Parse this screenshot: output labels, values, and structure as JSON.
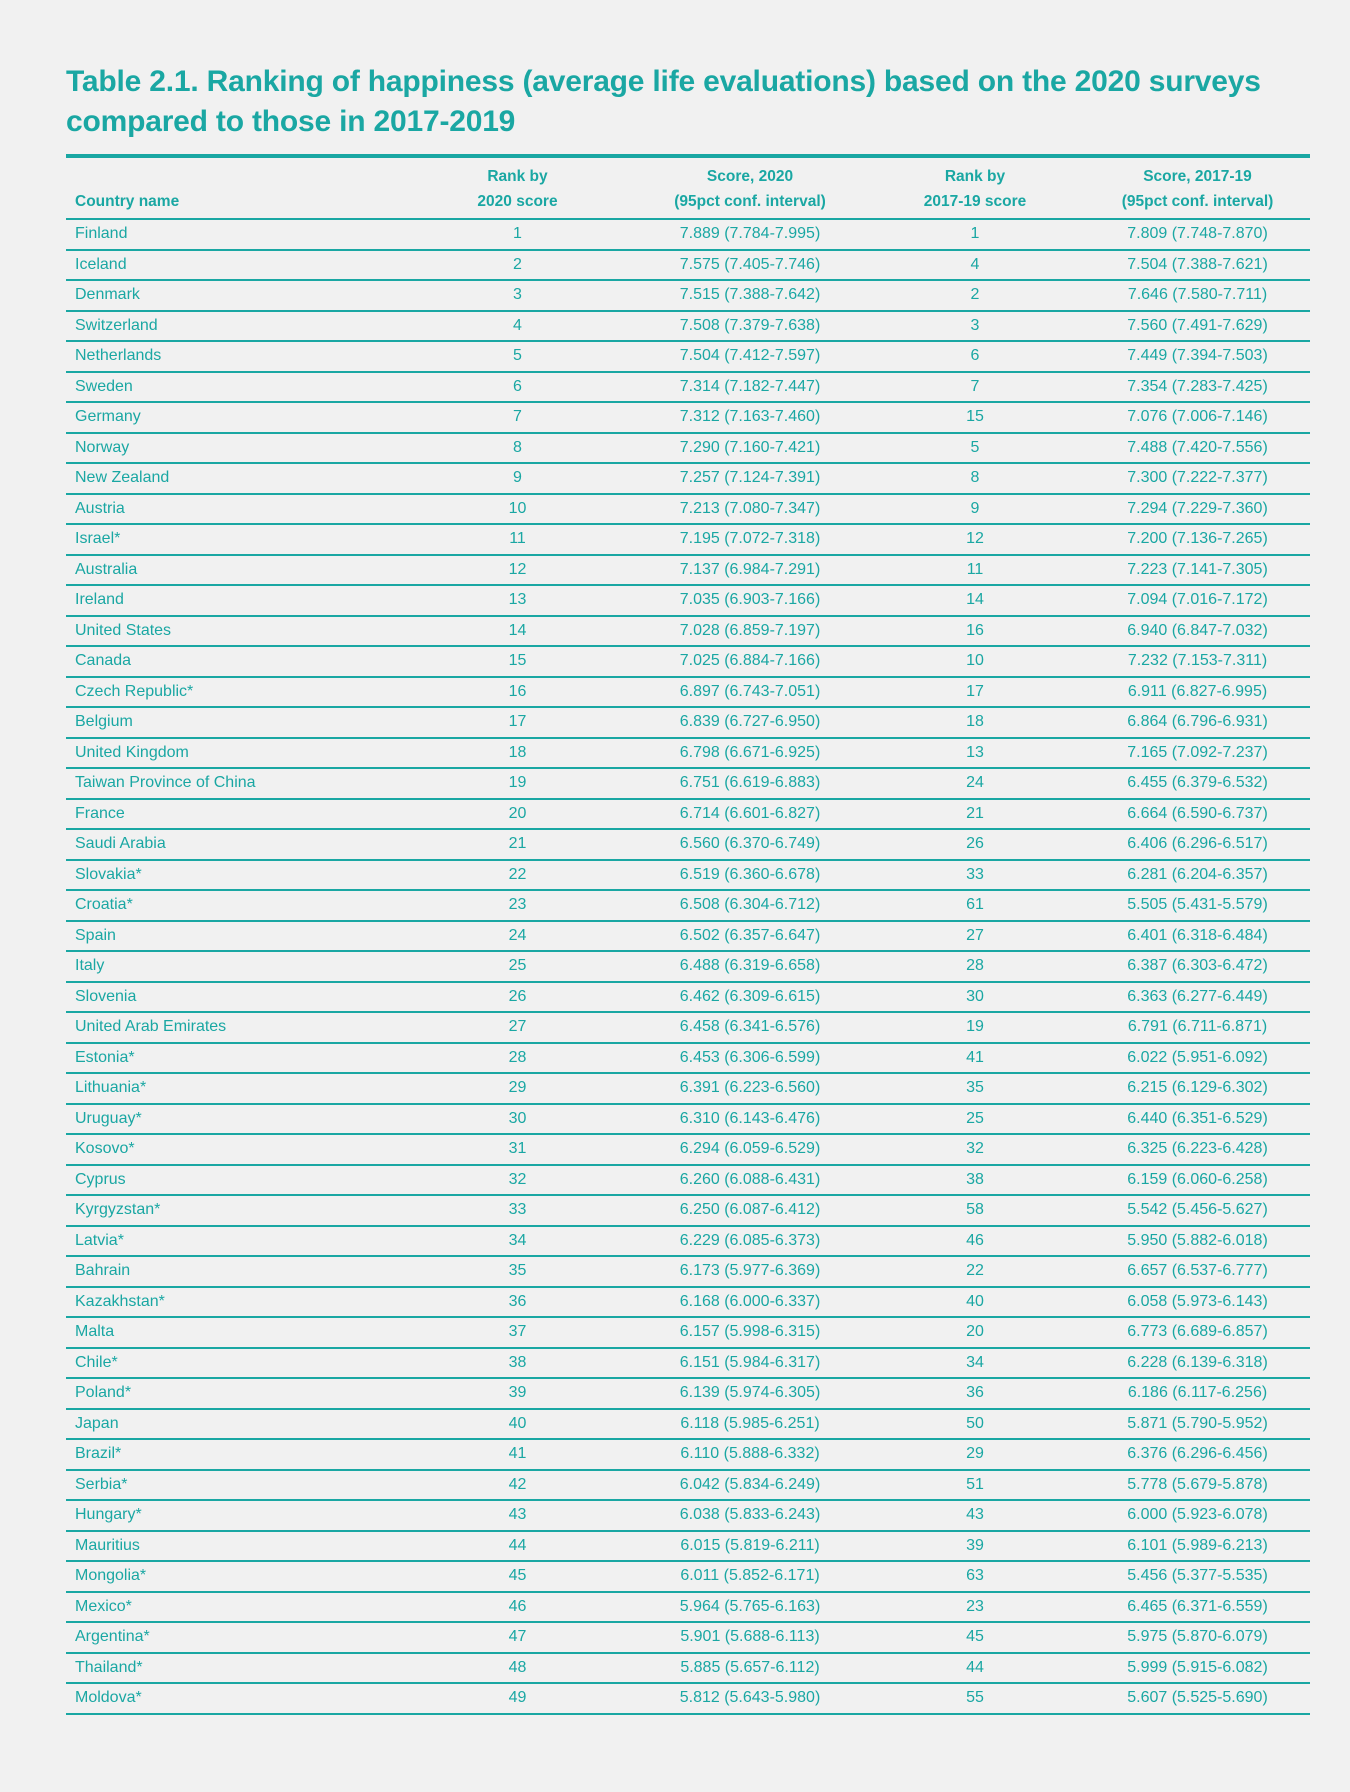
{
  "title": "Table 2.1. Ranking of happiness (average life evaluations) based on the 2020 surveys compared to those in 2017-2019",
  "colors": {
    "accent": "#1aa7a3",
    "background": "#f1f1f1"
  },
  "table": {
    "headers": [
      {
        "line1": "",
        "line2": "Country name"
      },
      {
        "line1": "Rank by",
        "line2": "2020 score"
      },
      {
        "line1": "Score, 2020",
        "line2": "(95pct conf. interval)"
      },
      {
        "line1": "Rank by",
        "line2": "2017-19 score"
      },
      {
        "line1": "Score, 2017-19",
        "line2": "(95pct conf. interval)"
      }
    ],
    "rows": [
      [
        "Finland",
        "1",
        "7.889 (7.784-7.995)",
        "1",
        "7.809 (7.748-7.870)"
      ],
      [
        "Iceland",
        "2",
        "7.575 (7.405-7.746)",
        "4",
        "7.504 (7.388-7.621)"
      ],
      [
        "Denmark",
        "3",
        "7.515 (7.388-7.642)",
        "2",
        "7.646 (7.580-7.711)"
      ],
      [
        "Switzerland",
        "4",
        "7.508 (7.379-7.638)",
        "3",
        "7.560 (7.491-7.629)"
      ],
      [
        "Netherlands",
        "5",
        "7.504 (7.412-7.597)",
        "6",
        "7.449 (7.394-7.503)"
      ],
      [
        "Sweden",
        "6",
        "7.314 (7.182-7.447)",
        "7",
        "7.354 (7.283-7.425)"
      ],
      [
        "Germany",
        "7",
        "7.312 (7.163-7.460)",
        "15",
        "7.076 (7.006-7.146)"
      ],
      [
        "Norway",
        "8",
        "7.290 (7.160-7.421)",
        "5",
        "7.488 (7.420-7.556)"
      ],
      [
        "New Zealand",
        "9",
        "7.257 (7.124-7.391)",
        "8",
        "7.300 (7.222-7.377)"
      ],
      [
        "Austria",
        "10",
        "7.213 (7.080-7.347)",
        "9",
        "7.294 (7.229-7.360)"
      ],
      [
        "Israel*",
        "11",
        "7.195 (7.072-7.318)",
        "12",
        "7.200 (7.136-7.265)"
      ],
      [
        "Australia",
        "12",
        "7.137 (6.984-7.291)",
        "11",
        "7.223 (7.141-7.305)"
      ],
      [
        "Ireland",
        "13",
        "7.035 (6.903-7.166)",
        "14",
        "7.094 (7.016-7.172)"
      ],
      [
        "United States",
        "14",
        "7.028 (6.859-7.197)",
        "16",
        "6.940 (6.847-7.032)"
      ],
      [
        "Canada",
        "15",
        "7.025 (6.884-7.166)",
        "10",
        "7.232 (7.153-7.311)"
      ],
      [
        "Czech Republic*",
        "16",
        "6.897 (6.743-7.051)",
        "17",
        "6.911 (6.827-6.995)"
      ],
      [
        "Belgium",
        "17",
        "6.839 (6.727-6.950)",
        "18",
        "6.864 (6.796-6.931)"
      ],
      [
        "United Kingdom",
        "18",
        "6.798 (6.671-6.925)",
        "13",
        "7.165 (7.092-7.237)"
      ],
      [
        "Taiwan Province of China",
        "19",
        "6.751 (6.619-6.883)",
        "24",
        "6.455 (6.379-6.532)"
      ],
      [
        "France",
        "20",
        "6.714 (6.601-6.827)",
        "21",
        "6.664 (6.590-6.737)"
      ],
      [
        "Saudi Arabia",
        "21",
        "6.560 (6.370-6.749)",
        "26",
        "6.406 (6.296-6.517)"
      ],
      [
        "Slovakia*",
        "22",
        "6.519 (6.360-6.678)",
        "33",
        "6.281 (6.204-6.357)"
      ],
      [
        "Croatia*",
        "23",
        "6.508 (6.304-6.712)",
        "61",
        "5.505 (5.431-5.579)"
      ],
      [
        "Spain",
        "24",
        "6.502 (6.357-6.647)",
        "27",
        "6.401 (6.318-6.484)"
      ],
      [
        "Italy",
        "25",
        "6.488 (6.319-6.658)",
        "28",
        "6.387 (6.303-6.472)"
      ],
      [
        "Slovenia",
        "26",
        "6.462 (6.309-6.615)",
        "30",
        "6.363 (6.277-6.449)"
      ],
      [
        "United Arab Emirates",
        "27",
        "6.458 (6.341-6.576)",
        "19",
        "6.791 (6.711-6.871)"
      ],
      [
        "Estonia*",
        "28",
        "6.453 (6.306-6.599)",
        "41",
        "6.022 (5.951-6.092)"
      ],
      [
        "Lithuania*",
        "29",
        "6.391 (6.223-6.560)",
        "35",
        "6.215 (6.129-6.302)"
      ],
      [
        "Uruguay*",
        "30",
        "6.310 (6.143-6.476)",
        "25",
        "6.440 (6.351-6.529)"
      ],
      [
        "Kosovo*",
        "31",
        "6.294 (6.059-6.529)",
        "32",
        "6.325 (6.223-6.428)"
      ],
      [
        "Cyprus",
        "32",
        "6.260 (6.088-6.431)",
        "38",
        "6.159 (6.060-6.258)"
      ],
      [
        "Kyrgyzstan*",
        "33",
        "6.250 (6.087-6.412)",
        "58",
        "5.542 (5.456-5.627)"
      ],
      [
        "Latvia*",
        "34",
        "6.229 (6.085-6.373)",
        "46",
        "5.950 (5.882-6.018)"
      ],
      [
        "Bahrain",
        "35",
        "6.173 (5.977-6.369)",
        "22",
        "6.657 (6.537-6.777)"
      ],
      [
        "Kazakhstan*",
        "36",
        "6.168 (6.000-6.337)",
        "40",
        "6.058 (5.973-6.143)"
      ],
      [
        "Malta",
        "37",
        "6.157 (5.998-6.315)",
        "20",
        "6.773 (6.689-6.857)"
      ],
      [
        "Chile*",
        "38",
        "6.151 (5.984-6.317)",
        "34",
        "6.228 (6.139-6.318)"
      ],
      [
        "Poland*",
        "39",
        "6.139 (5.974-6.305)",
        "36",
        "6.186 (6.117-6.256)"
      ],
      [
        "Japan",
        "40",
        "6.118 (5.985-6.251)",
        "50",
        "5.871 (5.790-5.952)"
      ],
      [
        "Brazil*",
        "41",
        "6.110 (5.888-6.332)",
        "29",
        "6.376 (6.296-6.456)"
      ],
      [
        "Serbia*",
        "42",
        "6.042 (5.834-6.249)",
        "51",
        "5.778 (5.679-5.878)"
      ],
      [
        "Hungary*",
        "43",
        "6.038 (5.833-6.243)",
        "43",
        "6.000 (5.923-6.078)"
      ],
      [
        "Mauritius",
        "44",
        "6.015 (5.819-6.211)",
        "39",
        "6.101 (5.989-6.213)"
      ],
      [
        "Mongolia*",
        "45",
        "6.011 (5.852-6.171)",
        "63",
        "5.456 (5.377-5.535)"
      ],
      [
        "Mexico*",
        "46",
        "5.964 (5.765-6.163)",
        "23",
        "6.465 (6.371-6.559)"
      ],
      [
        "Argentina*",
        "47",
        "5.901 (5.688-6.113)",
        "45",
        "5.975 (5.870-6.079)"
      ],
      [
        "Thailand*",
        "48",
        "5.885 (5.657-6.112)",
        "44",
        "5.999 (5.915-6.082)"
      ],
      [
        "Moldova*",
        "49",
        "5.812 (5.643-5.980)",
        "55",
        "5.607 (5.525-5.690)"
      ]
    ]
  }
}
